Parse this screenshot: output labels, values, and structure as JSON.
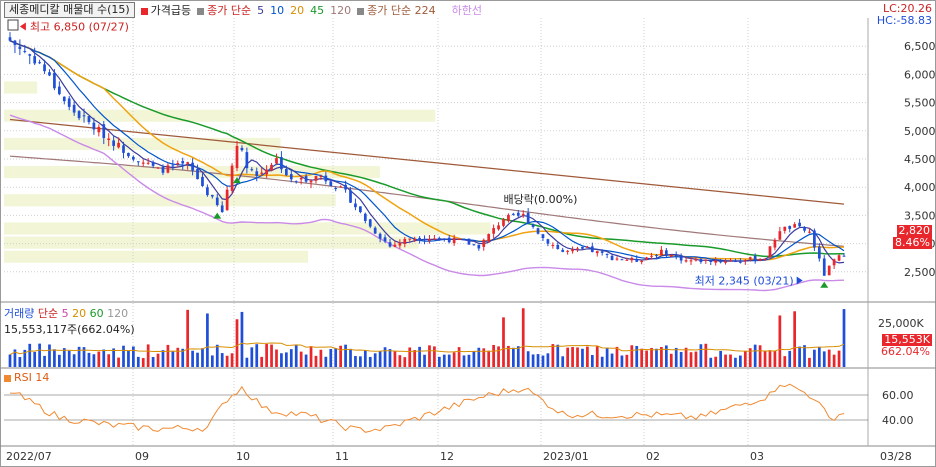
{
  "header": {
    "title": "세종메디칼 매물대 수(15)",
    "price_label": "가격급등",
    "ma_label": "종가 단순",
    "ma_periods": [
      "5",
      "10",
      "20",
      "45",
      "120"
    ],
    "ma_long_label": "종가 단순 224",
    "lower_limit_label": "하한선",
    "lc_text": "LC:20.26",
    "hc_text": "HC:-58.83"
  },
  "colors": {
    "up": "#e8262b",
    "down": "#1f4fd8",
    "ma5": "#3d3d9e",
    "ma10": "#0055cc",
    "ma20": "#f0a20f",
    "ma45": "#1a9a2a",
    "ma120": "#a07878",
    "ma224": "#a05a3a",
    "lower": "#c98ae8",
    "volume_profile": "#f2f5d6",
    "rsi": "#f08a32",
    "grid": "#cfcfcf"
  },
  "annotations": {
    "high": "최고 6,850 (07/27)",
    "low": "최저 2,345 (03/21)",
    "dividend": "배당락(0.00%)"
  },
  "price_axis": [
    "6,500",
    "6,000",
    "5,500",
    "5,000",
    "4,500",
    "4,000",
    "3,500",
    "3,000",
    "2,500"
  ],
  "price_badges": {
    "close": "2,820",
    "change": "8.46%"
  },
  "volume": {
    "legend_label": "거래량",
    "ma_label": "단순",
    "ma_periods": [
      "5",
      "20",
      "60",
      "120"
    ],
    "info": "15,553,117주(662.04%)",
    "axis_top": "25,000K",
    "badge": "15,553K",
    "pct": "662.04%"
  },
  "rsi": {
    "label": "RSI 14",
    "axis": [
      "60.00",
      "40.00"
    ]
  },
  "x_axis": [
    "2022/07",
    "09",
    "10",
    "11",
    "12",
    "2023/01",
    "02",
    "03",
    "03/28"
  ],
  "chart_data": {
    "type": "candlestick",
    "title": "세종메디칼 매물대 수(15)",
    "ylim": [
      2000,
      7000
    ],
    "high": 6850,
    "low": 2345,
    "last_close": 2820,
    "last_change_pct": 8.46,
    "close_keypoints": [
      {
        "i": 0,
        "v": 6600
      },
      {
        "i": 6,
        "v": 6200
      },
      {
        "i": 12,
        "v": 5400
      },
      {
        "i": 18,
        "v": 5000
      },
      {
        "i": 24,
        "v": 4600
      },
      {
        "i": 30,
        "v": 4300
      },
      {
        "i": 36,
        "v": 4400
      },
      {
        "i": 40,
        "v": 3900
      },
      {
        "i": 43,
        "v": 3550
      },
      {
        "i": 46,
        "v": 4800
      },
      {
        "i": 48,
        "v": 4400
      },
      {
        "i": 50,
        "v": 4200
      },
      {
        "i": 54,
        "v": 4500
      },
      {
        "i": 57,
        "v": 4100
      },
      {
        "i": 63,
        "v": 4200
      },
      {
        "i": 68,
        "v": 3900
      },
      {
        "i": 73,
        "v": 3300
      },
      {
        "i": 77,
        "v": 2950
      },
      {
        "i": 81,
        "v": 3100
      },
      {
        "i": 86,
        "v": 3100
      },
      {
        "i": 91,
        "v": 3050
      },
      {
        "i": 95,
        "v": 2950
      },
      {
        "i": 100,
        "v": 3450
      },
      {
        "i": 104,
        "v": 3500
      },
      {
        "i": 108,
        "v": 3100
      },
      {
        "i": 112,
        "v": 2850
      },
      {
        "i": 117,
        "v": 2900
      },
      {
        "i": 122,
        "v": 2750
      },
      {
        "i": 127,
        "v": 2700
      },
      {
        "i": 132,
        "v": 2850
      },
      {
        "i": 137,
        "v": 2700
      },
      {
        "i": 143,
        "v": 2700
      },
      {
        "i": 148,
        "v": 2700
      },
      {
        "i": 153,
        "v": 2750
      },
      {
        "i": 156,
        "v": 3250
      },
      {
        "i": 159,
        "v": 3300
      },
      {
        "i": 162,
        "v": 3200
      },
      {
        "i": 165,
        "v": 2450
      },
      {
        "i": 167,
        "v": 2700
      },
      {
        "i": 169,
        "v": 2820
      }
    ],
    "volume_profile_bars": [
      {
        "price": 5625,
        "w": 0.06
      },
      {
        "price": 5125,
        "w": 0.78
      },
      {
        "price": 4625,
        "w": 0.5
      },
      {
        "price": 4125,
        "w": 0.68
      },
      {
        "price": 3625,
        "w": 0.6
      },
      {
        "price": 3125,
        "w": 0.88
      },
      {
        "price": 2875,
        "w": 0.75
      },
      {
        "price": 2625,
        "w": 0.55
      }
    ],
    "rsi_keypoints": [
      {
        "i": 0,
        "v": 63
      },
      {
        "i": 10,
        "v": 42
      },
      {
        "i": 20,
        "v": 36
      },
      {
        "i": 30,
        "v": 33
      },
      {
        "i": 40,
        "v": 34
      },
      {
        "i": 44,
        "v": 57
      },
      {
        "i": 47,
        "v": 66
      },
      {
        "i": 52,
        "v": 48
      },
      {
        "i": 60,
        "v": 44
      },
      {
        "i": 70,
        "v": 32
      },
      {
        "i": 76,
        "v": 33
      },
      {
        "i": 86,
        "v": 46
      },
      {
        "i": 96,
        "v": 59
      },
      {
        "i": 104,
        "v": 66
      },
      {
        "i": 112,
        "v": 45
      },
      {
        "i": 120,
        "v": 44
      },
      {
        "i": 130,
        "v": 44
      },
      {
        "i": 140,
        "v": 42
      },
      {
        "i": 148,
        "v": 52
      },
      {
        "i": 154,
        "v": 60
      },
      {
        "i": 156,
        "v": 70
      },
      {
        "i": 160,
        "v": 64
      },
      {
        "i": 163,
        "v": 58
      },
      {
        "i": 166,
        "v": 41
      },
      {
        "i": 169,
        "v": 46
      }
    ]
  }
}
